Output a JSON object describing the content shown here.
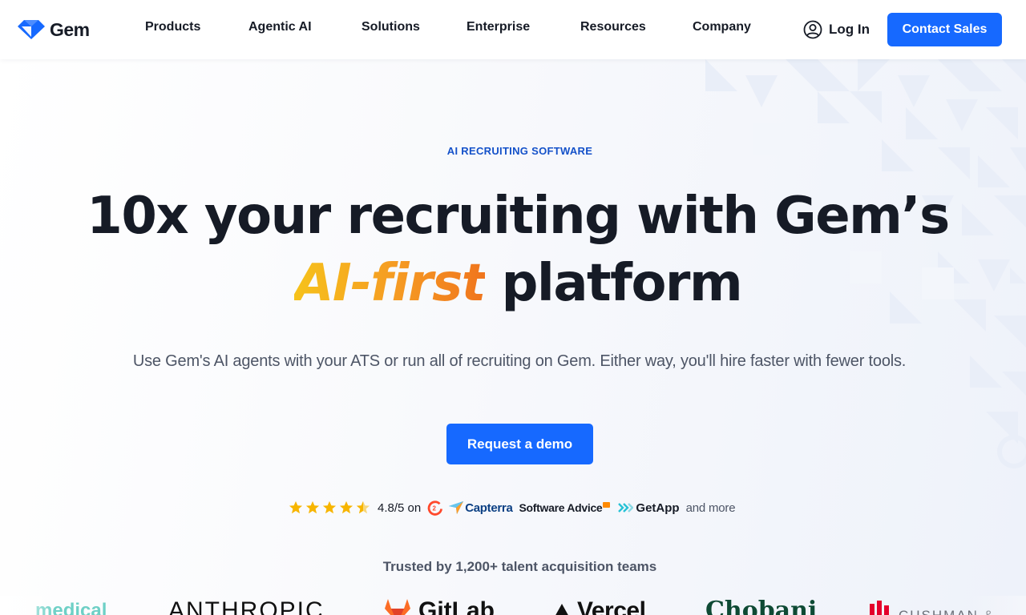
{
  "header": {
    "logo_text": "Gem",
    "nav": [
      {
        "label": "Products"
      },
      {
        "label": "Agentic AI"
      },
      {
        "label": "Solutions"
      },
      {
        "label": "Enterprise"
      },
      {
        "label": "Resources"
      },
      {
        "label": "Company"
      }
    ],
    "login_label": "Log In",
    "contact_label": "Contact Sales"
  },
  "hero": {
    "eyebrow": "AI RECRUITING SOFTWARE",
    "headline_line1": "10x your recruiting with Gem’s",
    "headline_highlight": "AI-first",
    "headline_line2_rest": " platform",
    "subtitle": "Use Gem's AI agents with your ATS or run all of recruiting on Gem. Either way, you'll hire faster with fewer tools.",
    "cta_label": "Request a demo"
  },
  "rating": {
    "stars": 4.5,
    "text": "4.8/5 on",
    "platforms": [
      "Capterra",
      "Software Advice",
      "GetApp"
    ],
    "and_more": "and more"
  },
  "trusted": {
    "label": "Trusted by 1,200+ talent acquisition teams",
    "logos": [
      "medical",
      "ANTHROPIC",
      "GitLab",
      "Vercel",
      "Chobani",
      "CUSHMAN &"
    ]
  },
  "colors": {
    "brand_blue": "#1669ff",
    "eyebrow_blue": "#1451c9",
    "highlight_start": "#f6c21b",
    "highlight_end": "#f0751d",
    "star": "#f7b500"
  },
  "icons": [
    "gem-logo-icon",
    "user-circle-icon",
    "star-icon",
    "g2-icon",
    "capterra-icon",
    "getapp-icon",
    "gitlab-icon",
    "vercel-icon",
    "cushman-icon"
  ]
}
